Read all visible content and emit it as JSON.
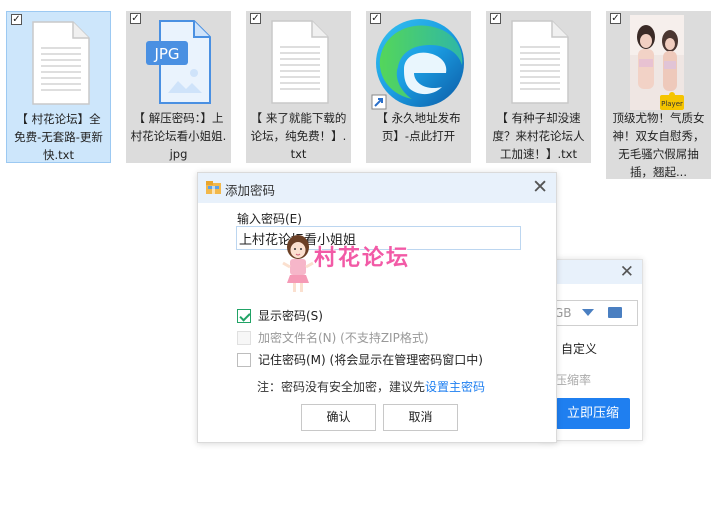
{
  "files": [
    {
      "name": "【 村花论坛】全免费-无套路-更新快.txt",
      "type": "txt",
      "checked": true,
      "selected": true
    },
    {
      "name": "【 解压密码：】上村花论坛看小姐姐.jpg",
      "type": "jpg",
      "badge": "JPG",
      "checked": true
    },
    {
      "name": "【 来了就能下载的论坛，纯免费！】.txt",
      "type": "txt",
      "checked": true
    },
    {
      "name": "【 永久地址发布页】-点此打开",
      "type": "shortcut",
      "checked": true
    },
    {
      "name": "【 有种子却没速度？来村花论坛人工加速！】.txt",
      "type": "txt",
      "checked": true
    },
    {
      "name": "顶级尤物！气质女神！双女自慰秀，无毛骚穴假屌抽插，翘起...",
      "type": "video",
      "badge": "Player",
      "checked": true
    }
  ],
  "dialog": {
    "title": "添加密码",
    "password_label": "输入密码(E)",
    "password_value": "上村花论坛看小姐姐",
    "watermark_text": "村花论坛",
    "show_password": {
      "label": "显示密码(S)",
      "checked": true
    },
    "encrypt_filenames": {
      "label": "加密文件名(N) (不支持ZIP格式)",
      "checked": false,
      "disabled": true
    },
    "remember_password": {
      "label": "记住密码(M) (将会显示在管理密码窗口中)",
      "checked": false
    },
    "note_prefix": "注：密码没有安全加密，建议先",
    "note_link": "设置主密码",
    "confirm_label": "确认",
    "cancel_label": "取消"
  },
  "back_dialog": {
    "size_partial": "GB",
    "option_custom": "自定义",
    "option_partial": "压缩率",
    "compress_now_label": "立即压缩"
  },
  "colors": {
    "accent": "#1f7ff0",
    "selected_tile": "#cde6fb",
    "watermark": "#f25aa6",
    "check_green": "#21a366"
  }
}
